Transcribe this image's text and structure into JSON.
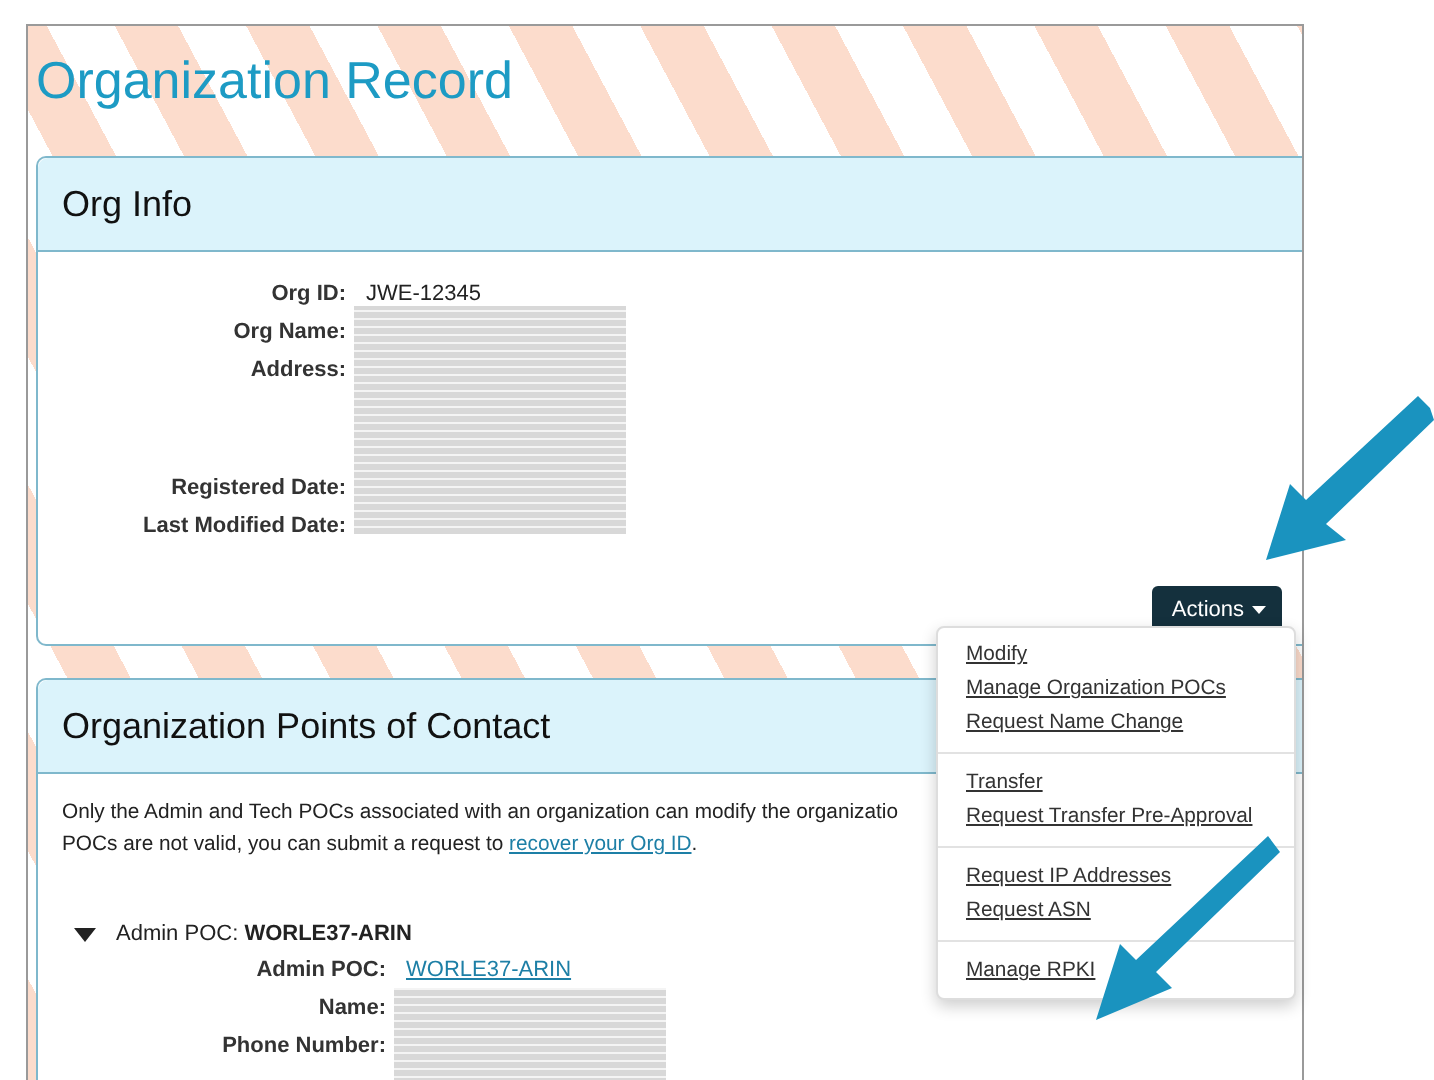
{
  "page": {
    "title": "Organization Record"
  },
  "org_info": {
    "title": "Org Info",
    "fields": [
      {
        "label": "Org ID:",
        "value": "JWE-12345"
      },
      {
        "label": "Org Name:"
      },
      {
        "label": "Address:"
      },
      {
        "label": "Registered Date:"
      },
      {
        "label": "Last Modified Date:"
      }
    ],
    "actions_button": "Actions"
  },
  "actions_menu": {
    "groups": [
      [
        "Modify",
        "Manage Organization POCs",
        "Request Name Change"
      ],
      [
        "Transfer",
        "Request Transfer Pre-Approval"
      ],
      [
        "Request IP Addresses",
        "Request ASN"
      ],
      [
        "Manage RPKI"
      ]
    ]
  },
  "poc": {
    "title": "Organization Points of Contact",
    "note_line1": "Only the Admin and Tech POCs associated with an organization can modify the organizatio",
    "note_line2": "POCs are not valid, you can submit a request to ",
    "note_link": "recover your Org ID",
    "note_end": ".",
    "sections": [
      {
        "label": "Admin POC:",
        "handle": "WORLE37-ARIN",
        "expanded": true,
        "fields": [
          {
            "label": "Admin POC:",
            "value": "WORLE37-ARIN",
            "kind": "link"
          },
          {
            "label": "Name:",
            "kind": "redacted"
          },
          {
            "label": "Phone Number:",
            "kind": "redacted"
          }
        ]
      }
    ]
  }
}
